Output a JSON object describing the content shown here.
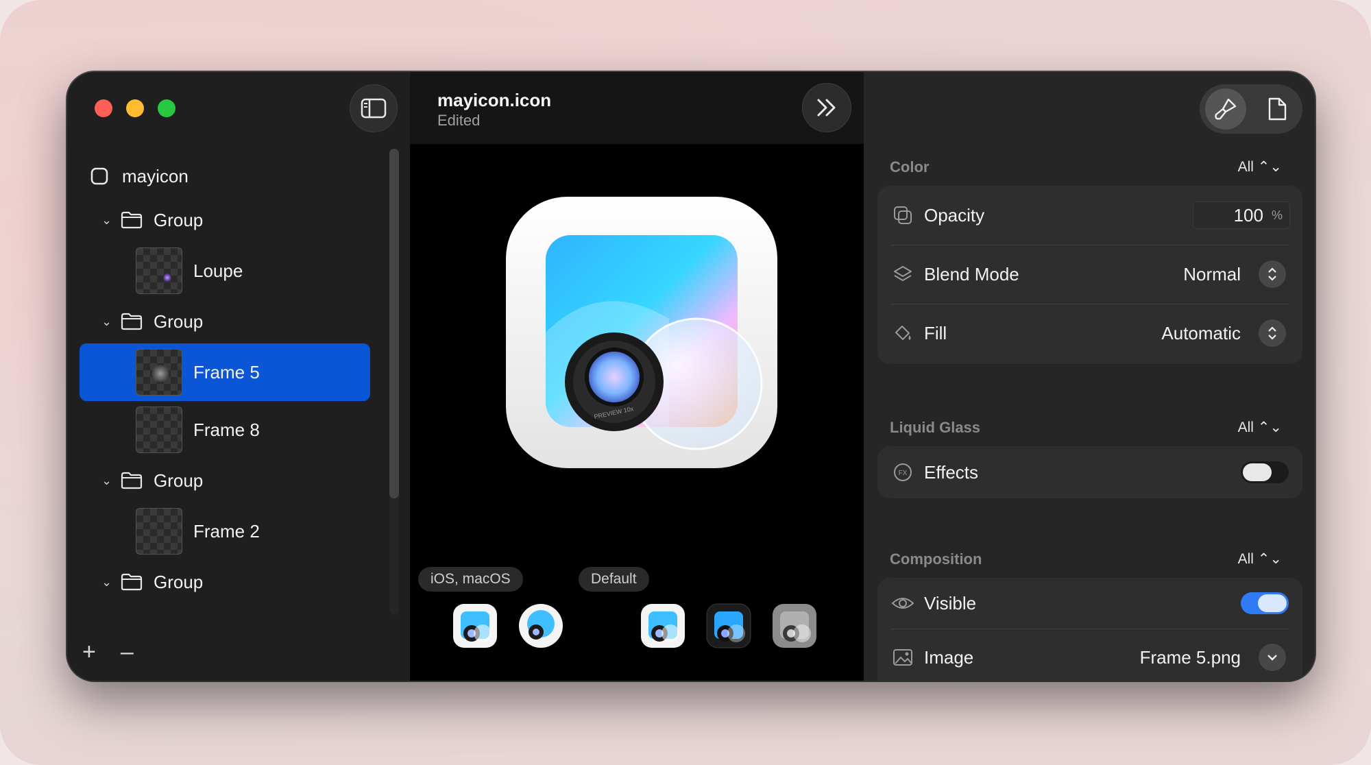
{
  "sidebar": {
    "root_label": "mayicon",
    "items": [
      {
        "type": "group",
        "label": "Group"
      },
      {
        "type": "layer",
        "label": "Loupe"
      },
      {
        "type": "group",
        "label": "Group"
      },
      {
        "type": "layer",
        "label": "Frame 5",
        "selected": true
      },
      {
        "type": "layer",
        "label": "Frame 8"
      },
      {
        "type": "group",
        "label": "Group"
      },
      {
        "type": "layer",
        "label": "Frame 2"
      },
      {
        "type": "group",
        "label": "Group"
      }
    ],
    "add_label": "+",
    "remove_label": "–"
  },
  "document": {
    "title": "mayicon.icon",
    "status": "Edited"
  },
  "canvas": {
    "platform_pill": "iOS, macOS",
    "appearance_pill": "Default"
  },
  "inspector": {
    "color_section": {
      "label": "Color",
      "scope": "All ⌃⌄",
      "opacity_label": "Opacity",
      "opacity_value": "100",
      "opacity_unit": "%",
      "blend_label": "Blend Mode",
      "blend_value": "Normal",
      "fill_label": "Fill",
      "fill_value": "Automatic"
    },
    "glass_section": {
      "label": "Liquid Glass",
      "scope": "All ⌃⌄",
      "effects_label": "Effects",
      "effects_on": false
    },
    "composition_section": {
      "label": "Composition",
      "scope": "All ⌃⌄",
      "visible_label": "Visible",
      "visible_on": true,
      "image_label": "Image",
      "image_value": "Frame 5.png"
    }
  },
  "colors": {
    "selection": "#0a56d6",
    "toggle_on": "#2f7bf5",
    "close": "#ff5f57",
    "minimize": "#febc2e",
    "zoom": "#28c840"
  }
}
